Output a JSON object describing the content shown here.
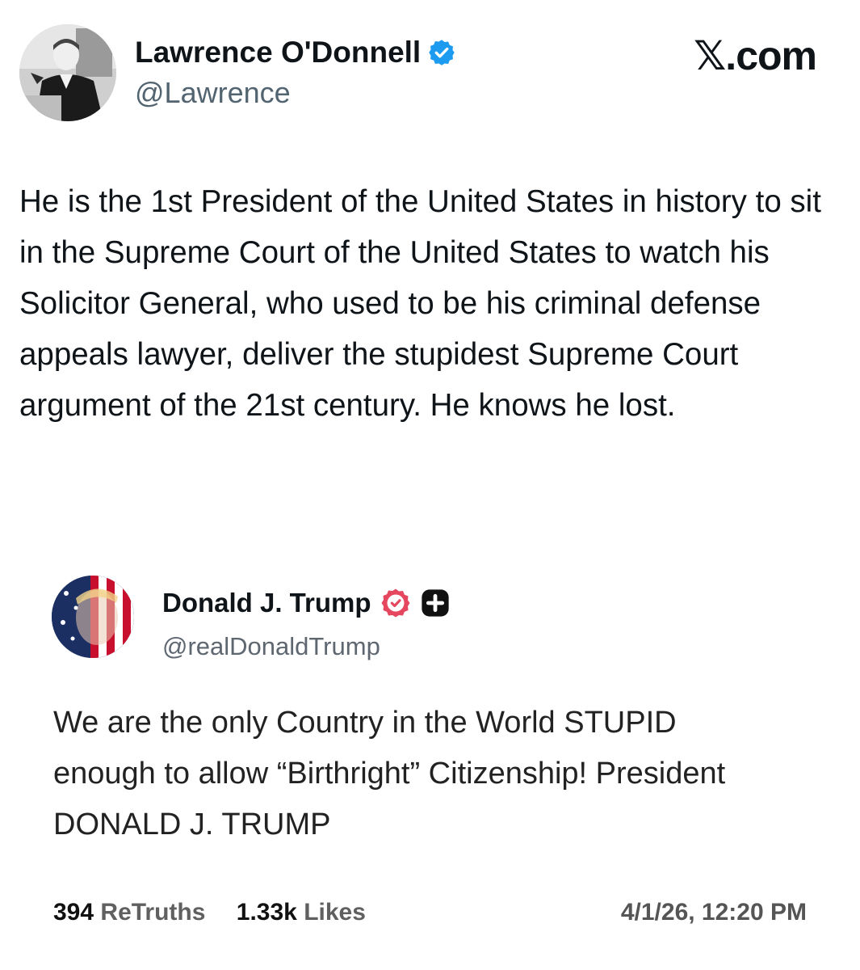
{
  "post": {
    "author_name": "Lawrence O'Donnell",
    "author_handle": "@Lawrence",
    "brand": "𝕏.com",
    "text": "He is the 1st President of the United States in history to sit in the Supreme Court of the United States to watch his Solicitor General, who used to be his criminal defense appeals lawyer, deliver the stupidest Supreme Court argument of the 21st century. He knows he lost."
  },
  "quoted": {
    "author_name": "Donald J. Trump",
    "author_handle": "@realDonaldTrump",
    "text": "We are the only Country in the World STUPID enough to allow “Birthright” Citizenship! President DONALD J. TRUMP",
    "retruths_count": "394",
    "retruths_label": "ReTruths",
    "likes_count": "1.33k",
    "likes_label": "Likes",
    "timestamp": "4/1/26, 12:20 PM"
  },
  "colors": {
    "x_verified": "#1d9bf0",
    "truth_verified": "#e5475f"
  },
  "icons": [
    "verified-badge-icon",
    "truth-verified-icon",
    "plus-badge-icon"
  ]
}
